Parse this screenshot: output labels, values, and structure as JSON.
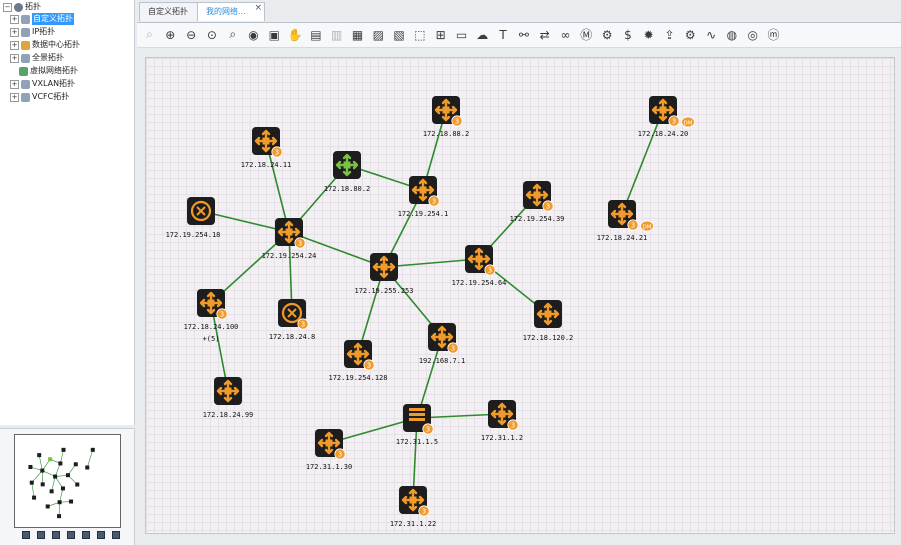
{
  "tree": {
    "root_label": "拓扑",
    "items": [
      {
        "label": "自定义拓扑",
        "selected": true,
        "expander": "+"
      },
      {
        "label": "IP拓扑",
        "selected": false,
        "expander": "+"
      },
      {
        "label": "数据中心拓扑",
        "selected": false,
        "expander": "+"
      },
      {
        "label": "全景拓扑",
        "selected": false,
        "expander": "+"
      },
      {
        "label": "虚拟网络拓扑",
        "selected": false,
        "expander": ""
      },
      {
        "label": "VXLAN拓扑",
        "selected": false,
        "expander": "+"
      },
      {
        "label": "VCFC拓扑",
        "selected": false,
        "expander": "+"
      }
    ]
  },
  "tabs": [
    {
      "label": "自定义拓扑",
      "active": false
    },
    {
      "label": "我的网络...",
      "active": true
    }
  ],
  "toolbar": {
    "tools": [
      "fit-icon",
      "zoom-in-icon",
      "zoom-out-icon",
      "zoom-fit-icon",
      "search-icon",
      "eye-icon",
      "fullscreen-icon",
      "hand-icon",
      "add-image-icon",
      "edit-image-icon",
      "save-icon",
      "picture-icon",
      "layers-icon",
      "select-icon",
      "topology-icon",
      "device-add-icon",
      "cloud-icon",
      "text-icon",
      "link-icon",
      "flow-icon",
      "binoculars-icon",
      "ms-tr-icon",
      "ms-gear-icon",
      "dollar-icon",
      "gear-icon",
      "export-icon",
      "settings-icon",
      "network-icon",
      "monitor-icon",
      "globe-icon",
      "help-icon"
    ]
  },
  "colors": {
    "link": "#2d8a2d",
    "device": "#1d1d1d",
    "arrow": "#f09a2a",
    "badge": "#f09a2a",
    "core": "#7bc143"
  },
  "nodes": [
    {
      "id": "n1",
      "label": "172.18.88.2",
      "type": "router",
      "badge": "3"
    },
    {
      "id": "n2",
      "label": "172.18.24.20",
      "type": "router",
      "badge": "3",
      "dm": "DM"
    },
    {
      "id": "n3",
      "label": "172.18.24.11",
      "type": "router",
      "badge": "3"
    },
    {
      "id": "n4",
      "label": "172.18.80.2",
      "type": "core"
    },
    {
      "id": "n5",
      "label": "172.19.254.1",
      "type": "router",
      "badge": "3"
    },
    {
      "id": "n6",
      "label": "172.19.254.39",
      "type": "router",
      "badge": "3"
    },
    {
      "id": "n7",
      "label": "172.18.24.21",
      "type": "router",
      "badge": "3",
      "dm": "DM"
    },
    {
      "id": "n8",
      "label": "172.19.254.18",
      "type": "switch"
    },
    {
      "id": "n9",
      "label": "172.19.254.24",
      "type": "router",
      "badge": "3"
    },
    {
      "id": "n10",
      "label": "172.19.255.253",
      "type": "router"
    },
    {
      "id": "n11",
      "label": "172.19.254.64",
      "type": "router",
      "badge": "3"
    },
    {
      "id": "n12",
      "label": "172.18.24.100",
      "type": "router",
      "badge": "3",
      "extra": "+(5)"
    },
    {
      "id": "n13",
      "label": "172.18.24.8",
      "type": "switch",
      "badge": "3"
    },
    {
      "id": "n14",
      "label": "172.18.120.2",
      "type": "router"
    },
    {
      "id": "n15",
      "label": "192.168.7.1",
      "type": "router",
      "badge": "3"
    },
    {
      "id": "n16",
      "label": "172.19.254.128",
      "type": "router",
      "badge": "3"
    },
    {
      "id": "n17",
      "label": "172.18.24.99",
      "type": "router"
    },
    {
      "id": "n18",
      "label": "172.31.1.5",
      "type": "server",
      "badge": "3"
    },
    {
      "id": "n19",
      "label": "172.31.1.2",
      "type": "router",
      "badge": "3"
    },
    {
      "id": "n20",
      "label": "172.31.1.30",
      "type": "router",
      "badge": "3"
    },
    {
      "id": "n21",
      "label": "172.31.1.22",
      "type": "router",
      "badge": "3"
    }
  ],
  "links": [
    [
      "n1",
      "n5"
    ],
    [
      "n2",
      "n7"
    ],
    [
      "n3",
      "n9"
    ],
    [
      "n4",
      "n9"
    ],
    [
      "n4",
      "n5"
    ],
    [
      "n5",
      "n10"
    ],
    [
      "n8",
      "n9"
    ],
    [
      "n9",
      "n10"
    ],
    [
      "n9",
      "n12"
    ],
    [
      "n9",
      "n13"
    ],
    [
      "n10",
      "n11"
    ],
    [
      "n11",
      "n6"
    ],
    [
      "n11",
      "n14"
    ],
    [
      "n10",
      "n15"
    ],
    [
      "n10",
      "n16"
    ],
    [
      "n12",
      "n17"
    ],
    [
      "n15",
      "n18"
    ],
    [
      "n18",
      "n19"
    ],
    [
      "n18",
      "n20"
    ],
    [
      "n18",
      "n21"
    ]
  ]
}
